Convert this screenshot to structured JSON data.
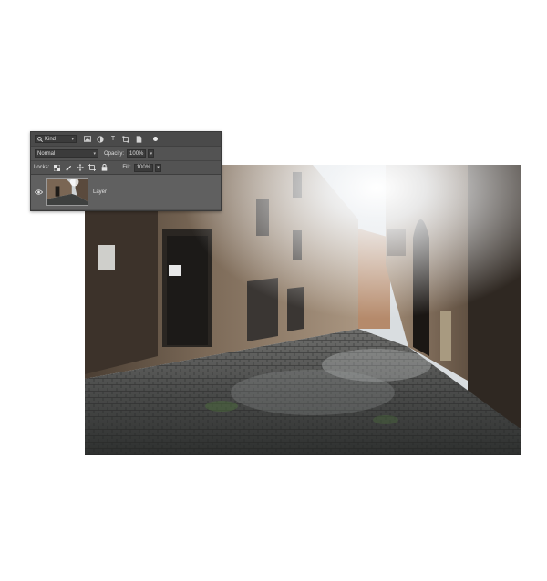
{
  "layers_panel": {
    "filter": {
      "kind_label": "Kind",
      "icons": [
        "image-filter-icon",
        "adjustment-filter-icon",
        "type-filter-icon",
        "shape-filter-icon",
        "smart-object-filter-icon"
      ],
      "type_glyph": "T"
    },
    "blend": {
      "mode": "Normal",
      "opacity_label": "Opacity:",
      "opacity_value": "100%"
    },
    "locks": {
      "label": "Locks:",
      "icons": [
        "lock-transparent-icon",
        "lock-image-icon",
        "lock-position-icon",
        "lock-artboard-icon",
        "lock-all-icon"
      ],
      "fill_label": "Fill:",
      "fill_value": "100%"
    },
    "layer": {
      "name": "Layer",
      "visible": true
    }
  },
  "colors": {
    "panel_bg": "#535353",
    "field_bg": "#3b3b3b",
    "selected_layer_bg": "#606060",
    "text": "#dcdcdc"
  }
}
